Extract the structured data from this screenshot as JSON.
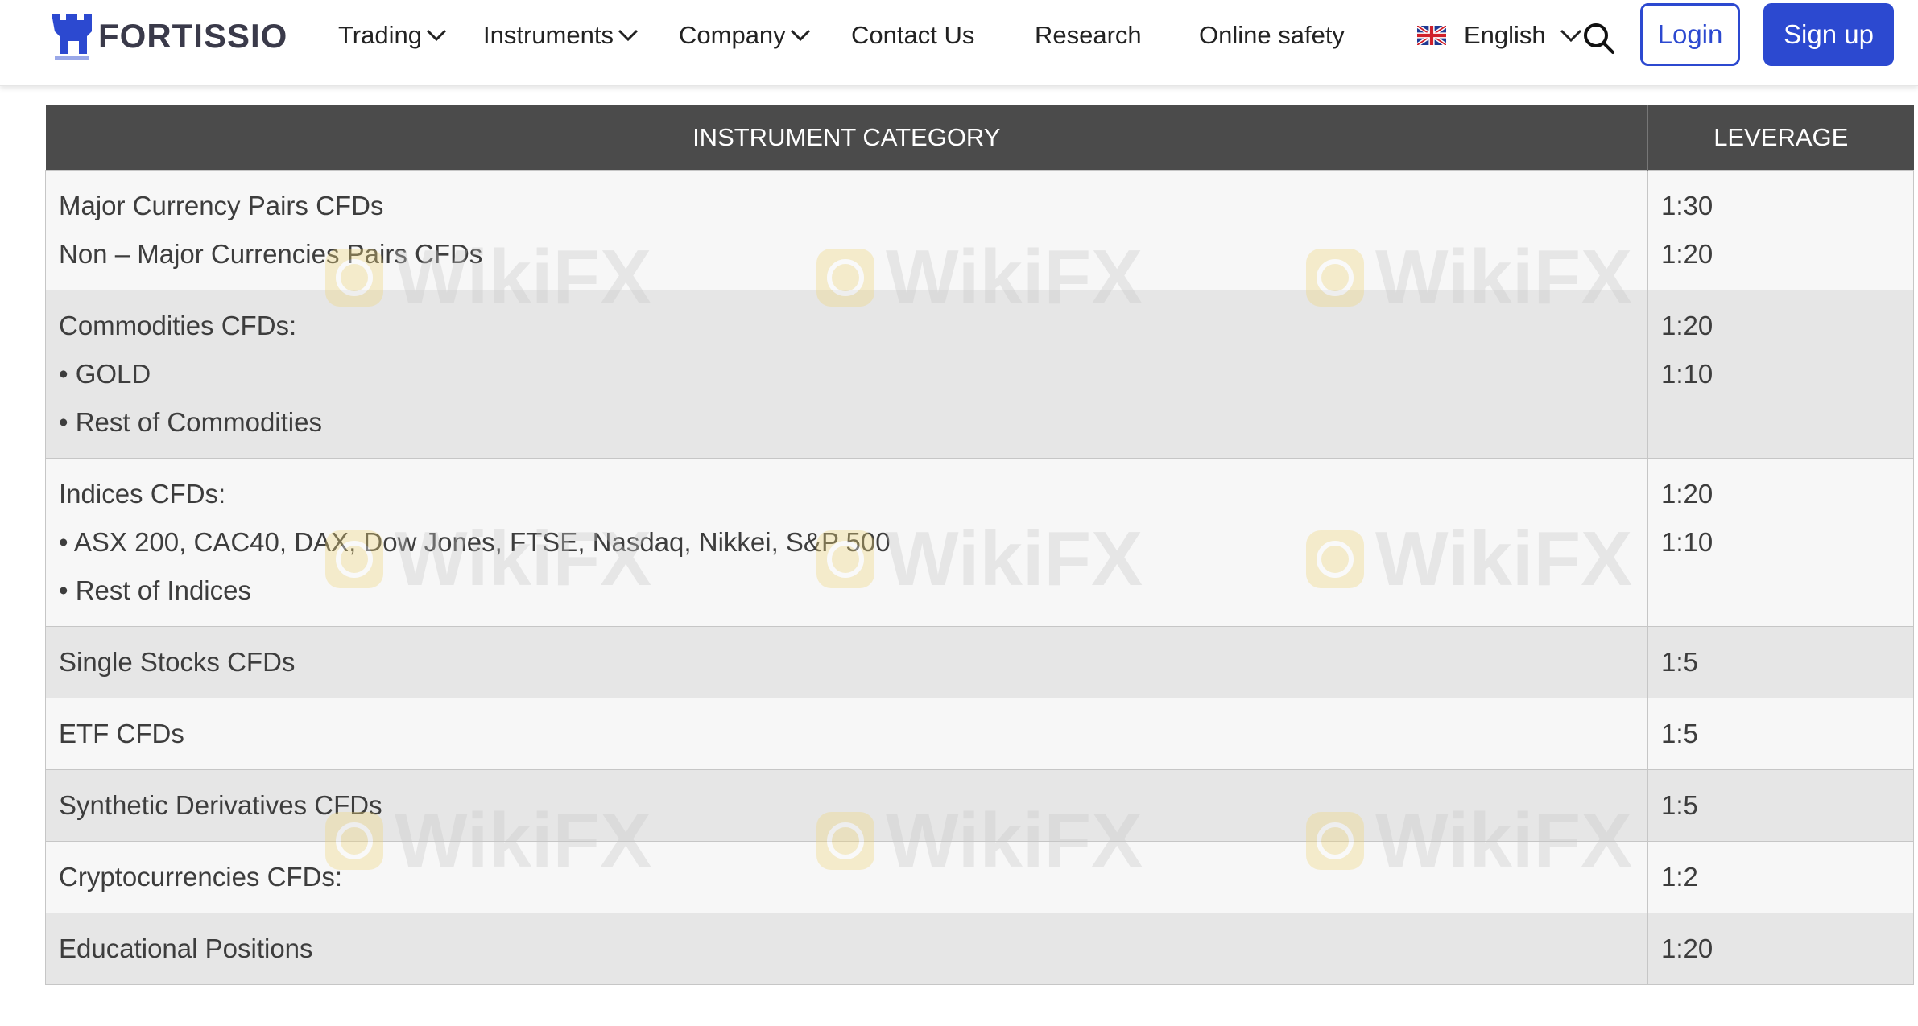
{
  "header": {
    "logo_text": "FORTISSIO",
    "nav": [
      {
        "label": "Trading",
        "has_dropdown": true
      },
      {
        "label": "Instruments",
        "has_dropdown": true
      },
      {
        "label": "Company",
        "has_dropdown": true
      },
      {
        "label": "Contact Us",
        "has_dropdown": false
      },
      {
        "label": "Research",
        "has_dropdown": false
      },
      {
        "label": "Online safety",
        "has_dropdown": false
      }
    ],
    "language": "English",
    "login_label": "Login",
    "signup_label": "Sign up",
    "icons": [
      "uk-flag-icon",
      "chevron-down-icon",
      "search-icon",
      "castle-logo-icon"
    ],
    "accent_color": "#2c49d0"
  },
  "table": {
    "headers": [
      "INSTRUMENT CATEGORY",
      "LEVERAGE"
    ],
    "rows": [
      {
        "category": [
          "Major Currency Pairs CFDs",
          "Non – Major Currencies Pairs CFDs"
        ],
        "leverage": [
          "1:30",
          "1:20"
        ]
      },
      {
        "category": [
          "Commodities CFDs:",
          "• GOLD",
          "• Rest of Commodities"
        ],
        "leverage": [
          "1:20",
          "1:10"
        ]
      },
      {
        "category": [
          "Indices CFDs:",
          "• ASX 200, CAC40, DAX, Dow Jones, FTSE, Nasdaq, Nikkei, S&P 500",
          "• Rest of Indices"
        ],
        "leverage": [
          "1:20",
          "1:10"
        ]
      },
      {
        "category": [
          "Single Stocks CFDs"
        ],
        "leverage": [
          "1:5"
        ]
      },
      {
        "category": [
          "ETF CFDs"
        ],
        "leverage": [
          "1:5"
        ]
      },
      {
        "category": [
          "Synthetic Derivatives CFDs"
        ],
        "leverage": [
          "1:5"
        ]
      },
      {
        "category": [
          "Cryptocurrencies CFDs:"
        ],
        "leverage": [
          "1:2"
        ]
      },
      {
        "category": [
          "Educational Positions"
        ],
        "leverage": [
          "1:20"
        ]
      }
    ],
    "header_bg": "#4b4b4b"
  },
  "watermark": {
    "text": "WikiFX"
  }
}
